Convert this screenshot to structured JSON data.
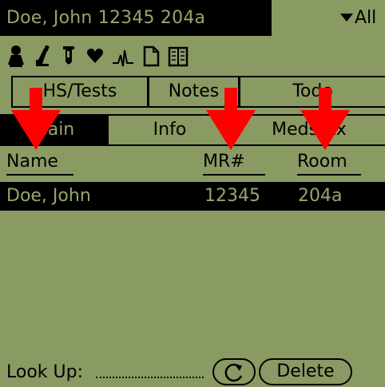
{
  "window": {
    "title": "Doe, John 12345 204a",
    "category_label": "All"
  },
  "icons": [
    "doctor-icon",
    "microscope-icon",
    "test-tube-icon",
    "heart-icon",
    "ecg-icon",
    "document-icon",
    "book-icon"
  ],
  "tabs_row1": [
    {
      "label": "HS/Tests"
    },
    {
      "label": "Notes"
    },
    {
      "label": "Todo"
    }
  ],
  "tabs_row2": [
    {
      "label": "Main",
      "selected": true
    },
    {
      "label": "Info"
    },
    {
      "label": "Meds/Rx"
    }
  ],
  "table": {
    "columns": [
      "Name",
      "MR#",
      "Room"
    ],
    "rows": [
      {
        "name": "Doe, John",
        "mr": "12345",
        "room": "204a",
        "selected": true
      }
    ]
  },
  "footer": {
    "lookup_label": "Look Up:",
    "lookup_value": "",
    "delete_label": "Delete"
  },
  "colors": {
    "screen": "#8a9a63",
    "highlight_text": "#93a86a",
    "annotation_arrow": "#ff0000"
  }
}
